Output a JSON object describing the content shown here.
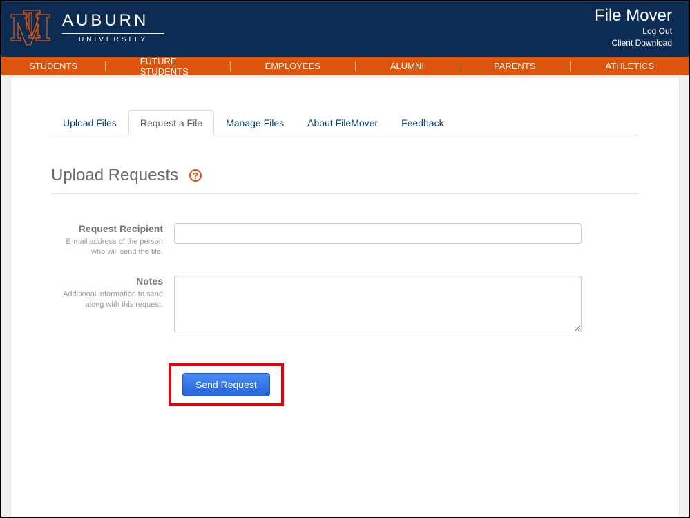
{
  "header": {
    "logo_alt": "Auburn University",
    "wordmark_top": "AUBURN",
    "wordmark_bottom": "UNIVERSITY",
    "app_title": "File Mover",
    "links": {
      "logout": "Log Out",
      "download": "Client Download"
    }
  },
  "nav": {
    "items": [
      "STUDENTS",
      "FUTURE STUDENTS",
      "EMPLOYEES",
      "ALUMNI",
      "PARENTS",
      "ATHLETICS"
    ]
  },
  "tabs": {
    "items": [
      {
        "label": "Upload Files"
      },
      {
        "label": "Request a File"
      },
      {
        "label": "Manage Files"
      },
      {
        "label": "About FileMover"
      },
      {
        "label": "Feedback"
      }
    ],
    "active_index": 1
  },
  "section": {
    "title": "Upload Requests",
    "help_glyph": "?"
  },
  "form": {
    "recipient": {
      "label": "Request Recipient",
      "help": "E-mail address of the person who will send the file.",
      "value": ""
    },
    "notes": {
      "label": "Notes",
      "help": "Additional information to send along with this request.",
      "value": ""
    },
    "submit_label": "Send Request"
  }
}
